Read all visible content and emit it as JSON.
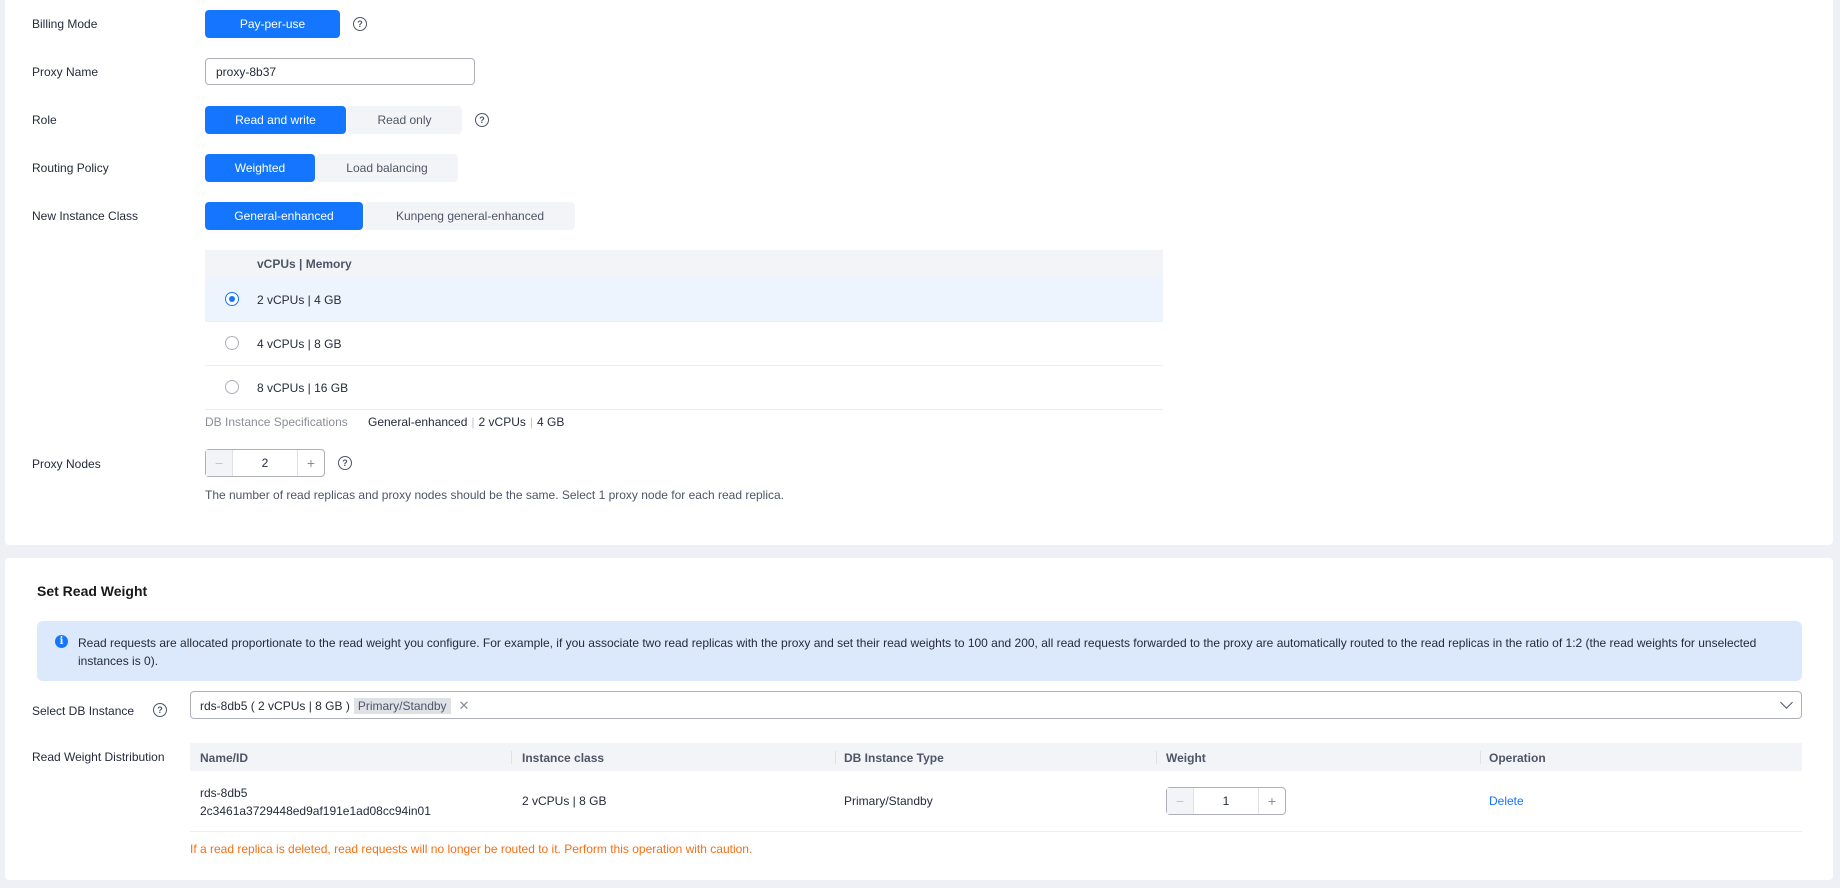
{
  "form": {
    "billing_mode": {
      "label": "Billing Mode",
      "option": "Pay-per-use"
    },
    "proxy_name": {
      "label": "Proxy Name",
      "value": "proxy-8b37"
    },
    "role": {
      "label": "Role",
      "options": [
        "Read and write",
        "Read only"
      ],
      "selected": "Read and write"
    },
    "routing_policy": {
      "label": "Routing Policy",
      "options": [
        "Weighted",
        "Load balancing"
      ],
      "selected": "Weighted"
    },
    "instance_class": {
      "label": "New Instance Class",
      "options": [
        "General-enhanced",
        "Kunpeng general-enhanced"
      ],
      "selected": "General-enhanced",
      "table_header": "vCPUs | Memory",
      "rows": [
        "2 vCPUs | 4 GB",
        "4 vCPUs | 8 GB",
        "8 vCPUs | 16 GB"
      ],
      "selected_row": "2 vCPUs | 4 GB"
    },
    "db_spec": {
      "label": "DB Instance Specifications",
      "type": "General-enhanced",
      "vcpus": "2 vCPUs",
      "memory": "4 GB"
    },
    "proxy_nodes": {
      "label": "Proxy Nodes",
      "value": "2",
      "hint": "The number of read replicas and proxy nodes should be the same. Select 1 proxy node for each read replica."
    }
  },
  "read_weight": {
    "title": "Set Read Weight",
    "info": "Read requests are allocated proportionate to the read weight you configure. For example, if you associate two read replicas with the proxy and set their read weights to 100 and 200, all read requests forwarded to the proxy are automatically routed to the read replicas in the ratio of 1:2 (the read weights for unselected instances is 0).",
    "select_label": "Select DB Instance",
    "selected_tag": "rds-8db5 ( 2 vCPUs | 8 GB )",
    "selected_tag_type": "Primary/Standby",
    "distribution_label": "Read Weight Distribution",
    "columns": [
      "Name/ID",
      "Instance class",
      "DB Instance Type",
      "Weight",
      "Operation"
    ],
    "rows": [
      {
        "name": "rds-8db5",
        "id": "2c3461a3729448ed9af191e1ad08cc94in01",
        "instance_class": "2 vCPUs | 8 GB",
        "type": "Primary/Standby",
        "weight": "1",
        "operation": "Delete"
      }
    ],
    "warning": "If a read replica is deleted, read requests will no longer be routed to it. Perform this operation with caution."
  },
  "colors": {
    "primary": "#1476ff",
    "warning": "#f66f15",
    "info_bg": "#dce8fc"
  },
  "icons": [
    "help-icon",
    "info-icon",
    "close-icon",
    "chevron-down-icon",
    "minus-icon",
    "plus-icon"
  ]
}
